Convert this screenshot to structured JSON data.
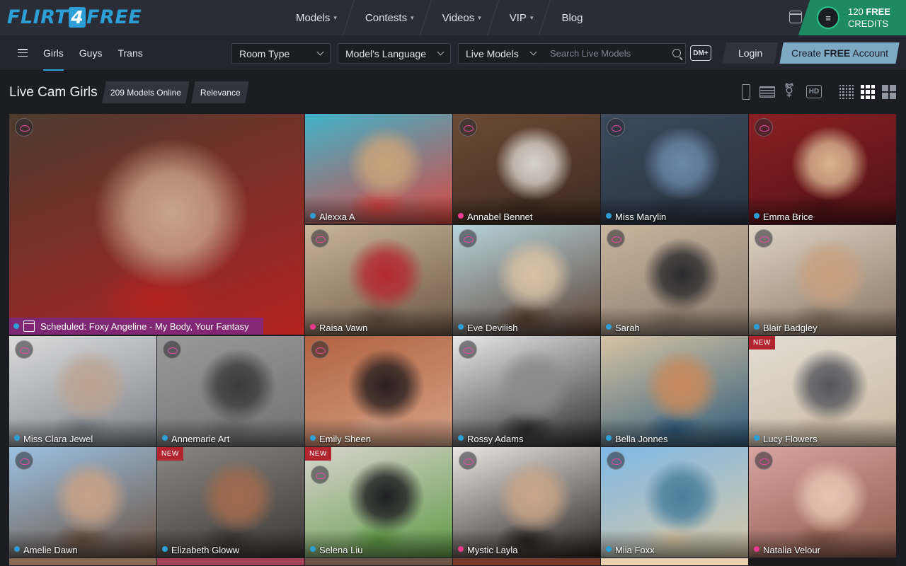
{
  "header": {
    "logo_left": "FLIRT",
    "logo_mid": "4",
    "logo_right": "FREE",
    "nav": [
      {
        "label": "Models",
        "dropdown": true
      },
      {
        "label": "Contests",
        "dropdown": true
      },
      {
        "label": "Videos",
        "dropdown": true
      },
      {
        "label": "VIP",
        "dropdown": true
      },
      {
        "label": "Blog",
        "dropdown": false
      }
    ],
    "credits_amount": "120",
    "credits_free": "FREE",
    "credits_label": "CREDITS"
  },
  "subbar": {
    "tabs": [
      "Girls",
      "Guys",
      "Trans"
    ],
    "active_tab": "Girls",
    "room_type": "Room Type",
    "language": "Model's Language",
    "live_models": "Live Models",
    "search_placeholder": "Search Live Models",
    "dm_label": "DM+",
    "login": "Login",
    "create_pre": "Create ",
    "create_bold": "FREE",
    "create_post": " Account"
  },
  "filters": {
    "title": "Live Cam Girls",
    "online": "209 Models Online",
    "sort": "Relevance",
    "hd": "HD"
  },
  "models": [
    {
      "name": "Alexxa A",
      "status": "#2c9fd7",
      "new": false,
      "badge": false,
      "photo": [
        "#3fb3c9",
        "#c9a47a",
        "#d94640"
      ]
    },
    {
      "name": "Annabel Bennet",
      "status": "#e93a8f",
      "new": false,
      "badge": true,
      "photo": [
        "#6b4a35",
        "#d8d2cc",
        "#3d2a20"
      ]
    },
    {
      "name": "Miss Marylin",
      "status": "#2c9fd7",
      "new": false,
      "badge": true,
      "photo": [
        "#3c4a5c",
        "#6a88a8",
        "#2a3442"
      ]
    },
    {
      "name": "Emma Brice",
      "status": "#2c9fd7",
      "new": false,
      "badge": true,
      "photo": [
        "#8a1f24",
        "#d9b48e",
        "#501216"
      ]
    },
    {
      "name": "Raisa Vawn",
      "status": "#e93a8f",
      "new": false,
      "badge": true,
      "photo": [
        "#c9b59a",
        "#b32a2e",
        "#6b5545"
      ]
    },
    {
      "name": "Eve Devilish",
      "status": "#2c9fd7",
      "new": false,
      "badge": true,
      "photo": [
        "#b7d4dc",
        "#d9c2a5",
        "#5a4032"
      ]
    },
    {
      "name": "Sarah",
      "status": "#2c9fd7",
      "new": false,
      "badge": true,
      "photo": [
        "#c8b49e",
        "#2b2b2e",
        "#8a7a6c"
      ]
    },
    {
      "name": "Blair Badgley",
      "status": "#2c9fd7",
      "new": false,
      "badge": true,
      "photo": [
        "#ddd3c4",
        "#c9a07e",
        "#8a7563"
      ]
    },
    {
      "name": "Miss Clara Jewel",
      "status": "#2c9fd7",
      "new": false,
      "badge": true,
      "photo": [
        "#dcdcdc",
        "#bca391",
        "#7b7f86"
      ]
    },
    {
      "name": "Annemarie Art",
      "status": "#2c9fd7",
      "new": false,
      "badge": true,
      "photo": [
        "#9a9a9a",
        "#3b3b3b",
        "#707070"
      ]
    },
    {
      "name": "Emily Sheen",
      "status": "#2c9fd7",
      "new": false,
      "badge": true,
      "photo": [
        "#b3623f",
        "#2a2020",
        "#d3a287"
      ]
    },
    {
      "name": "Rossy Adams",
      "status": "#2c9fd7",
      "new": false,
      "badge": true,
      "photo": [
        "#e8e8e8",
        "#8a8a8a",
        "#2d2d2d"
      ]
    },
    {
      "name": "Bella Jonnes",
      "status": "#2c9fd7",
      "new": false,
      "badge": false,
      "photo": [
        "#d6c4a4",
        "#c88a5c",
        "#2f5a7a"
      ]
    },
    {
      "name": "Lucy Flowers",
      "status": "#2c9fd7",
      "new": true,
      "badge": false,
      "photo": [
        "#e3ddd4",
        "#55565c",
        "#c9b8a0"
      ]
    },
    {
      "name": "Amelie Dawn",
      "status": "#2c9fd7",
      "new": false,
      "badge": true,
      "photo": [
        "#9cc2e3",
        "#c9a287",
        "#6a5140"
      ]
    },
    {
      "name": "Elizabeth Gloww",
      "status": "#2c9fd7",
      "new": true,
      "badge": false,
      "photo": [
        "#8a8680",
        "#a36b4d",
        "#3b3735"
      ]
    },
    {
      "name": "Selena Liu",
      "status": "#2c9fd7",
      "new": true,
      "badge": true,
      "photo": [
        "#d9d4cf",
        "#1f1f22",
        "#5f9a45"
      ]
    },
    {
      "name": "Mystic Layla",
      "status": "#e93a8f",
      "new": false,
      "badge": true,
      "photo": [
        "#e9e6e2",
        "#c9a688",
        "#2a2220"
      ]
    },
    {
      "name": "Miia Foxx",
      "status": "#2c9fd7",
      "new": false,
      "badge": true,
      "photo": [
        "#7eb8e6",
        "#4a7f9c",
        "#d9c8a6"
      ]
    },
    {
      "name": "Natalia Velour",
      "status": "#e93a8f",
      "new": false,
      "badge": true,
      "photo": [
        "#d9a3a0",
        "#e8c4b4",
        "#8a5a4c"
      ]
    }
  ],
  "featured": {
    "scheduled_label": "Scheduled:",
    "scheduled_title": "Foxy Angeline - My Body, Your Fantasy",
    "photo": [
      "#4c3b2f",
      "#c9a489",
      "#b3211f"
    ]
  },
  "colors": {
    "accent_blue": "#2c9fd7",
    "credits_green": "#1d8a63",
    "new_red": "#b2252e"
  }
}
